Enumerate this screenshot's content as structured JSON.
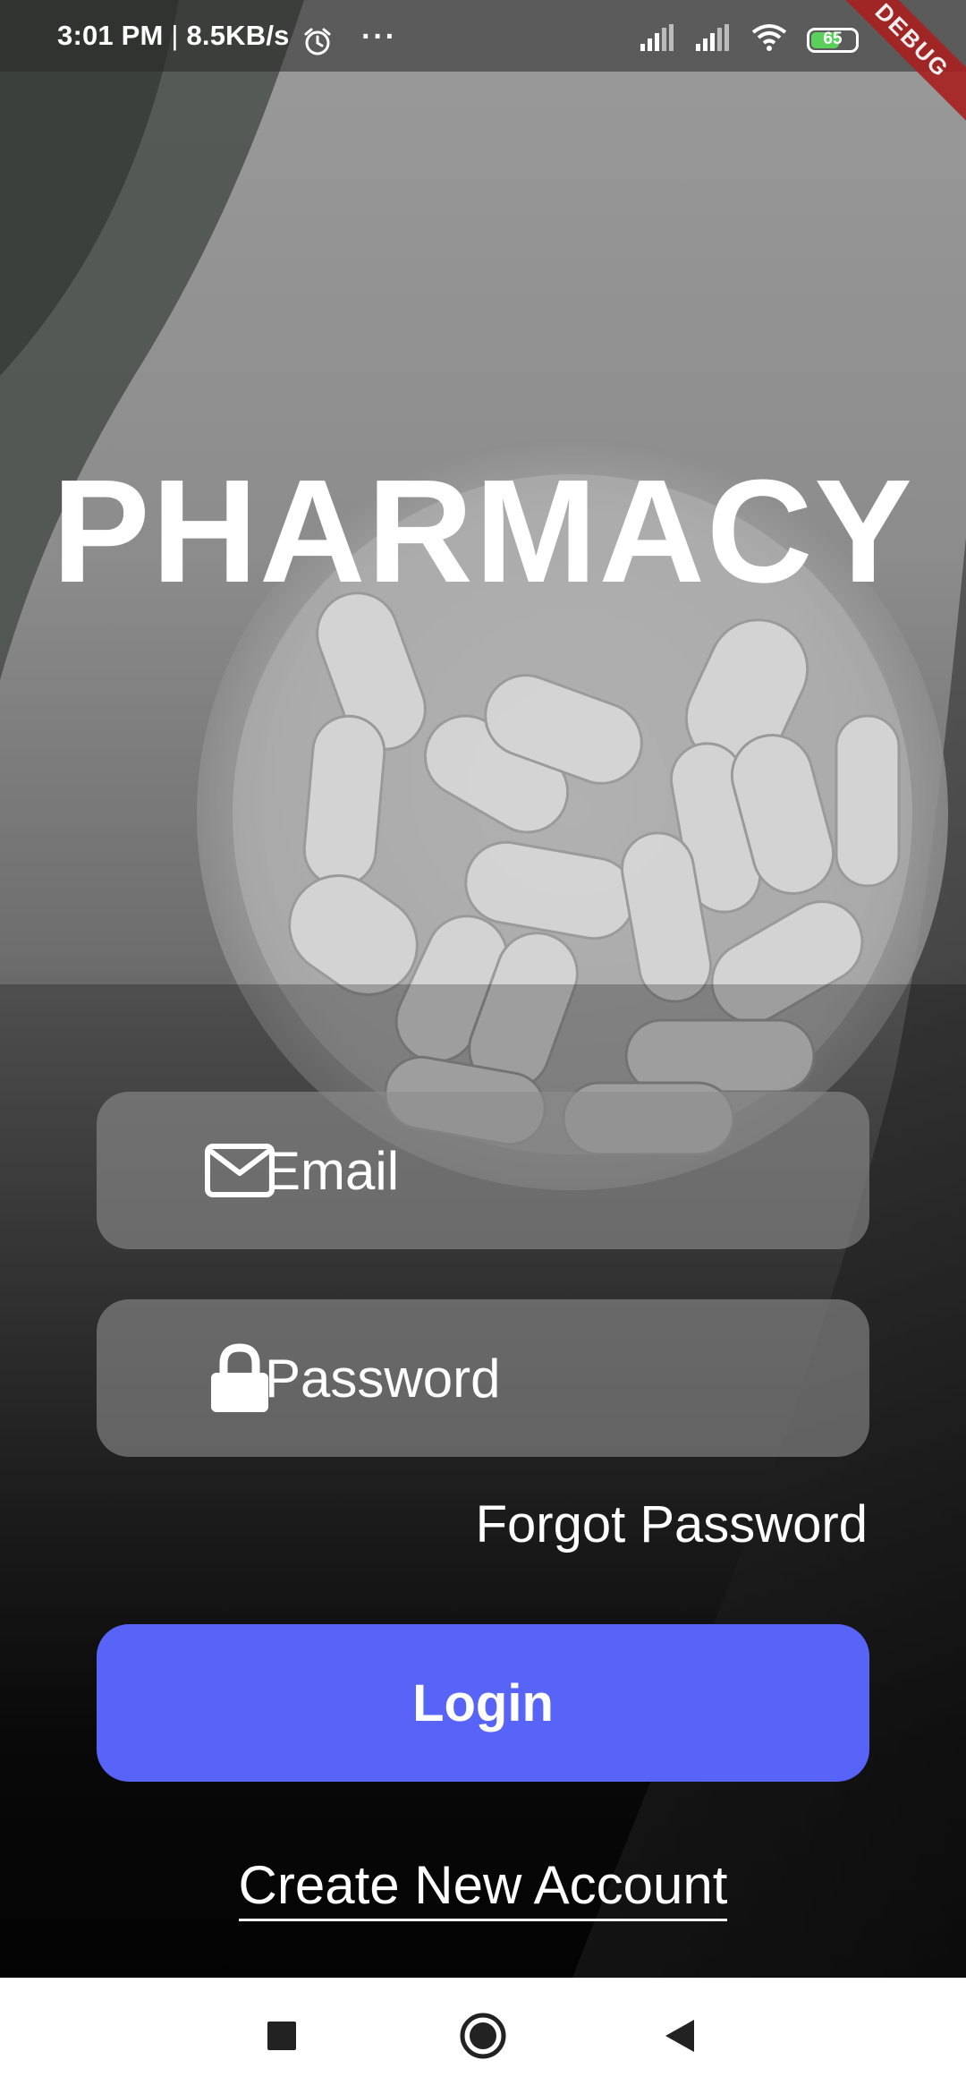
{
  "status_bar": {
    "time": "3:01 PM",
    "speed": "8.5KB/s",
    "separator": "|",
    "more": "···",
    "battery_level": "65",
    "battery_fraction": 0.65,
    "debug_label": "DEBUG"
  },
  "app": {
    "title": "PHARMACY"
  },
  "form": {
    "email_placeholder": "Email",
    "password_placeholder": "Password",
    "forgot_label": "Forgot Password",
    "login_label": "Login",
    "create_account_label": "Create New Account"
  },
  "colors": {
    "accent": "#5863f8",
    "field_bg": "rgba(140,140,140,0.62)",
    "text": "#ffffff"
  },
  "icons": {
    "email": "envelope-icon",
    "password": "lock-icon",
    "nav_recents": "square-icon",
    "nav_home": "circle-icon",
    "nav_back": "triangle-back-icon"
  }
}
